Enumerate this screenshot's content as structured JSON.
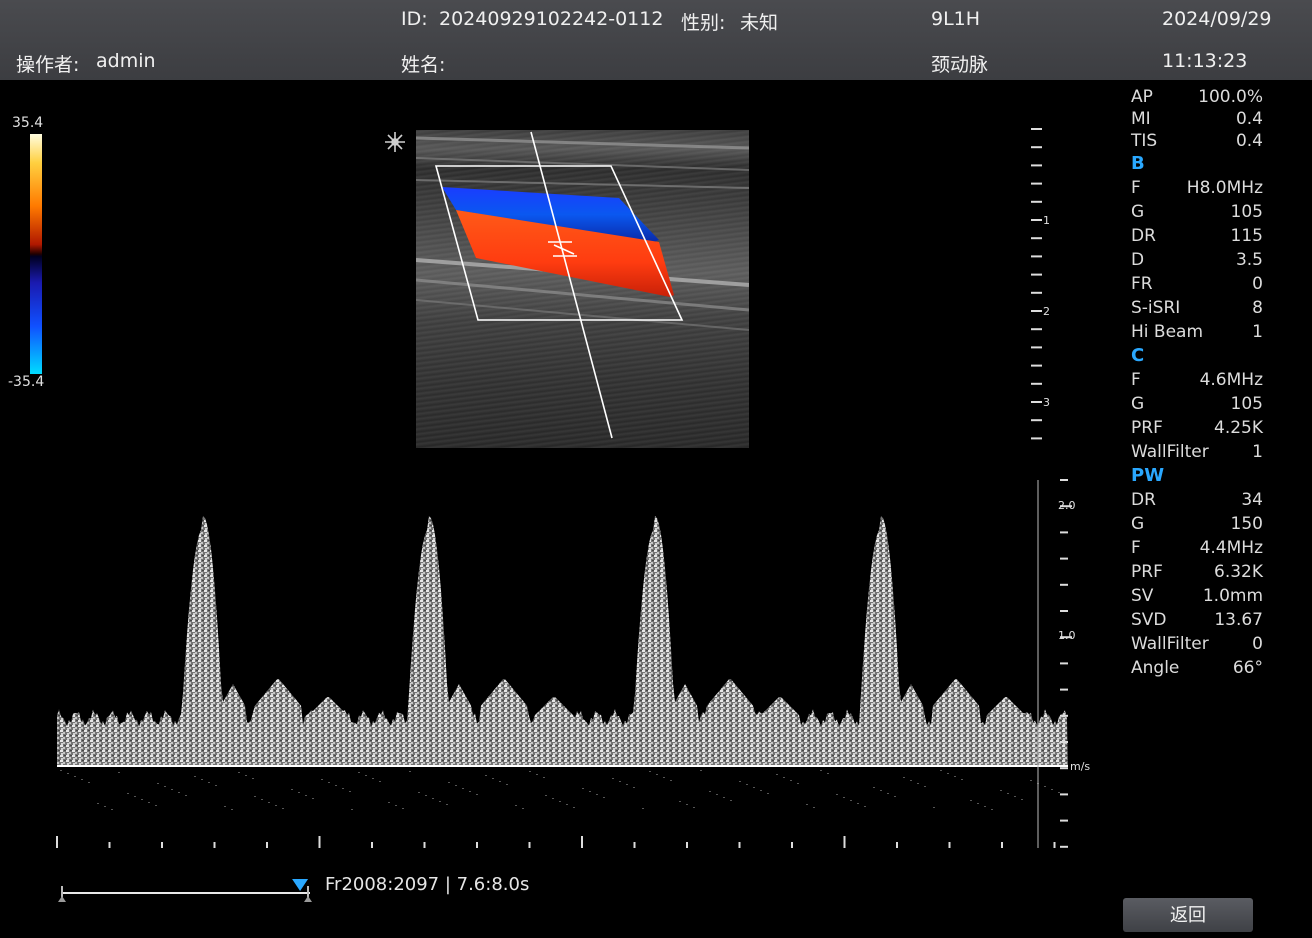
{
  "header": {
    "operator_label": "操作者:",
    "operator_value": "admin",
    "id_label": "ID:",
    "id_value": "20240929102242-0112",
    "gender_label": "性别:",
    "gender_value": "未知",
    "name_label": "姓名:",
    "name_value": "",
    "probe": "9L1H",
    "exam_preset": "颈动脉",
    "date": "2024/09/29",
    "time": "11:13:23"
  },
  "color_scale": {
    "max": "35.4",
    "min": "-35.4"
  },
  "params": {
    "top": [
      {
        "label": "AP",
        "value": "100.0%"
      },
      {
        "label": "MI",
        "value": "0.4"
      },
      {
        "label": "TIS",
        "value": "0.4"
      }
    ],
    "b_title": "B",
    "b": [
      {
        "label": "F",
        "value": "H8.0MHz"
      },
      {
        "label": "G",
        "value": "105"
      },
      {
        "label": "DR",
        "value": "115"
      },
      {
        "label": "D",
        "value": "3.5"
      },
      {
        "label": "FR",
        "value": "0"
      },
      {
        "label": "S-iSRI",
        "value": "8"
      },
      {
        "label": "Hi Beam",
        "value": "1"
      }
    ],
    "c_title": "C",
    "c": [
      {
        "label": "F",
        "value": "4.6MHz"
      },
      {
        "label": "G",
        "value": "105"
      },
      {
        "label": "PRF",
        "value": "4.25K"
      },
      {
        "label": "WallFilter",
        "value": "1"
      }
    ],
    "pw_title": "PW",
    "pw": [
      {
        "label": "DR",
        "value": "34"
      },
      {
        "label": "G",
        "value": "150"
      },
      {
        "label": "F",
        "value": "4.4MHz"
      },
      {
        "label": "PRF",
        "value": "6.32K"
      },
      {
        "label": "SV",
        "value": "1.0mm"
      },
      {
        "label": "SVD",
        "value": "13.67"
      },
      {
        "label": "WallFilter",
        "value": "0"
      },
      {
        "label": "Angle",
        "value": "66°"
      }
    ]
  },
  "depth_scale": {
    "labels": [
      "1",
      "2",
      "3"
    ]
  },
  "velocity_scale": {
    "labels": [
      "2.0",
      "1.0"
    ],
    "unit": "m/s"
  },
  "doppler": {
    "peaks_per_screen": 4
  },
  "cine": {
    "info": "Fr2008:2097 | 7.6:8.0s",
    "position": 0.96
  },
  "buttons": {
    "back": "返回"
  },
  "colors": {
    "accent": "#2aa8ff",
    "flow_red": "#ff3c10",
    "flow_blue": "#0a58f0"
  }
}
